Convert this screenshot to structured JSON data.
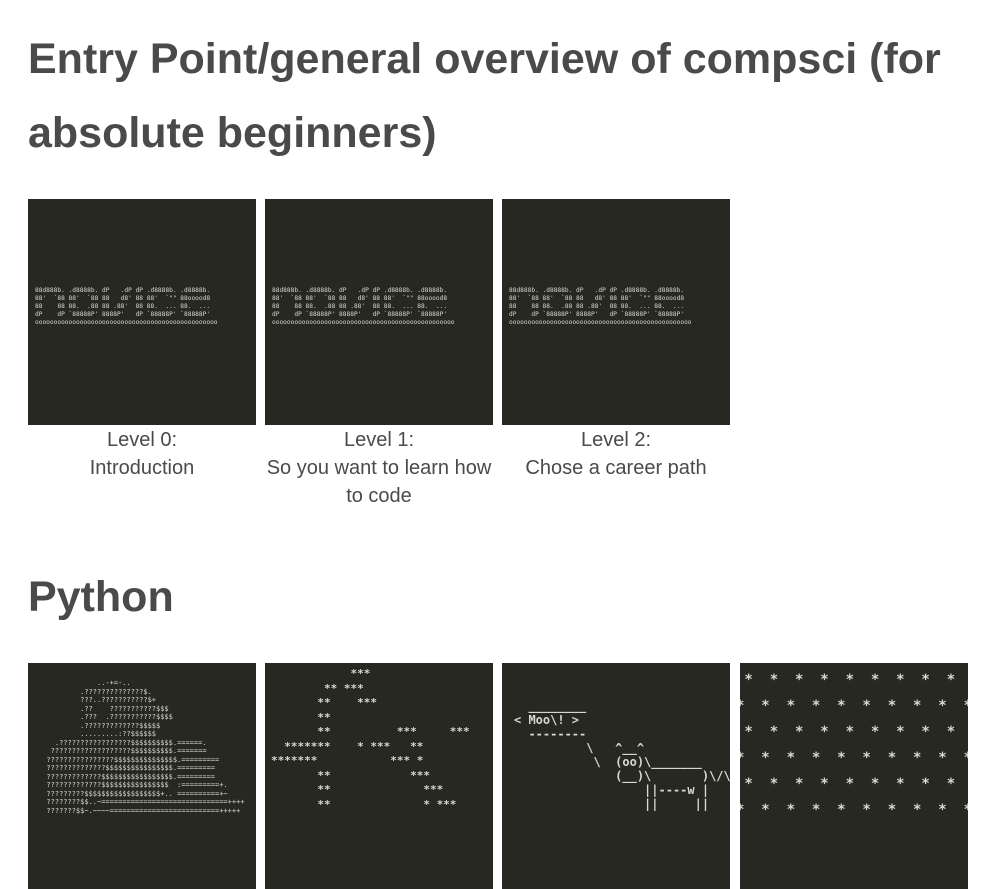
{
  "sections": [
    {
      "title": "Entry Point/general overview of compsci (for absolute beginners)",
      "cards": [
        {
          "caption_line1": "Level 0:",
          "caption_line2": "Introduction"
        },
        {
          "caption_line1": "Level 1:",
          "caption_line2": "So you want to learn how to code"
        },
        {
          "caption_line1": "Level 2:",
          "caption_line2": "Chose a career path"
        }
      ]
    },
    {
      "title": "Python"
    }
  ],
  "ascii": {
    "banner": "88d888b. .d8888b. dP   .dP dP .d8888b. .d8888b.\n88'  `88 88'  `88 88   d8' 88 88'  `\"\" 88ooood8\n88    88 88.  .88 88 .88'  88 88.  ... 88.  ...\ndP    dP `88888P' 8888P'   dP `88888P' `88888P'\nooooooooooooooooooooooooooooooooooooooooooooooooo",
    "python_art": "              ..-+=-..\n          .??????????????$.\n          ???..???????????$+\n          .??    ???????????$$$\n          .???  .???????????$$$$\n          .?????????????$$$$$\n          .........:??$$$$$$\n    .?????????????????$$$$$$$$$$.======.\n   ???????????????????$$$$$$$$$$.=======\n  ????????????????$$$$$$$$$$$$$$$.=========\n  ??????????????$$$$$$$$$$$$$$$$.=========\n  ?????????????$$$$$$$$$$$$$$$$$.=========\n  ?????????????$$$$$$$$$$$$$$$$  :=========+.\n  ?????????$$$$$$$$$$$$$$$$$$+.. ==========+~\n  ????????$$..~==============================++++\n  ???????$$~.~~~~==========================+++++",
    "stars_art": "            ***\n        ** ***\n       **    ***\n       **\n       **          ***     ***\n  *******    * ***   **\n*******           *** *\n       **            ***\n       **              ***\n       **              * ***",
    "cow_art": "  ________\n< Moo\\! >\n  --------\n          \\   ^__^\n           \\  (oo)\\_______\n              (__)\\       )\\/\\\n                  ||----w |\n                  ||     ||",
    "grid_art": " *  *  *  *  *  *  *  *  *  *\n*  *  *  *  *  *  *  *  *  *  *\n *  *  *  *  *  *  *  *  *  *\n*  *  *  *  *  *  *  *  *  *  *\n *  *  *  *  *  *  *  *  *  *\n*  *  *  *  *  *  *  *  *  *  *"
  }
}
